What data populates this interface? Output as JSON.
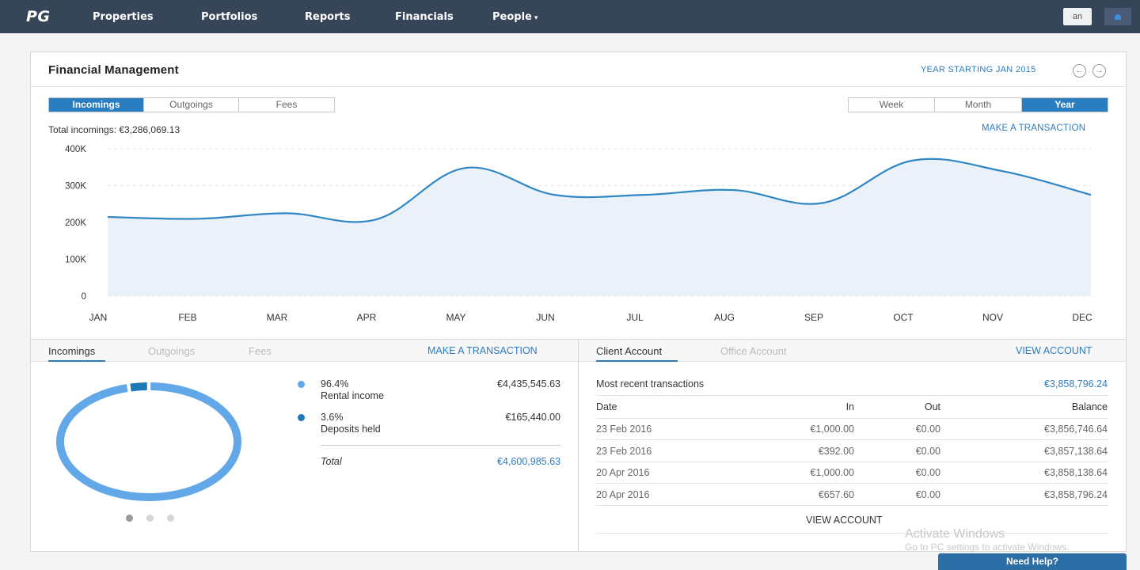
{
  "nav": {
    "logo": "PG",
    "items": [
      "Properties",
      "Portfolios",
      "Reports",
      "Financials",
      "People"
    ],
    "user_label": "an"
  },
  "header": {
    "title": "Financial Management",
    "year_label": "YEAR STARTING JAN 2015",
    "prev_icon": "←",
    "next_icon": "→"
  },
  "type_tabs": [
    "Incomings",
    "Outgoings",
    "Fees"
  ],
  "type_tab_active": 0,
  "period_tabs": [
    "Week",
    "Month",
    "Year"
  ],
  "period_tab_active": 2,
  "total_incomings": "Total incomings: €3,286,069.13",
  "make_transaction": "MAKE A TRANSACTION",
  "chart_data": {
    "type": "area",
    "categories": [
      "JAN",
      "FEB",
      "MAR",
      "APR",
      "MAY",
      "JUN",
      "JUL",
      "AUG",
      "SEP",
      "OCT",
      "NOV",
      "DEC"
    ],
    "y_tick_labels": [
      "400K",
      "300K",
      "200K",
      "100K",
      "0"
    ],
    "ylim": [
      0,
      400000
    ],
    "series": [
      {
        "values": [
          215000,
          210000,
          225000,
          208000,
          348000,
          275000,
          275000,
          288000,
          253000,
          368000,
          340000,
          275000
        ]
      }
    ],
    "colors": {
      "line": "#2f87c4",
      "fill": "#eaf1f8"
    },
    "grid": true
  },
  "bottom_left": {
    "tabs": [
      "Incomings",
      "Outgoings",
      "Fees"
    ],
    "active_tab": 0,
    "make_transaction": "MAKE A TRANSACTION",
    "donut": [
      {
        "pct": "96.4%",
        "name": "Rental income",
        "value": "€4,435,545.63",
        "fraction": 0.964,
        "color": "#62a8e8"
      },
      {
        "pct": "3.6%",
        "name": "Deposits held",
        "value": "€165,440.00",
        "fraction": 0.036,
        "color": "#1f78b8"
      }
    ],
    "total_label": "Total",
    "total_value": "€4,600,985.63"
  },
  "bottom_right": {
    "tabs": [
      "Client Account",
      "Office Account"
    ],
    "active_tab": 0,
    "view_account": "VIEW ACCOUNT",
    "recent_label": "Most recent transactions",
    "recent_value": "€3,858,796.24",
    "columns": [
      "Date",
      "In",
      "Out",
      "Balance"
    ],
    "rows": [
      {
        "date": "23 Feb 2016",
        "in": "€1,000.00",
        "out": "€0.00",
        "balance": "€3,856,746.64"
      },
      {
        "date": "23 Feb 2016",
        "in": "€392.00",
        "out": "€0.00",
        "balance": "€3,857,138.64"
      },
      {
        "date": "20 Apr 2016",
        "in": "€1,000.00",
        "out": "€0.00",
        "balance": "€3,858,138.64"
      },
      {
        "date": "20 Apr 2016",
        "in": "€657.60",
        "out": "€0.00",
        "balance": "€3,858,796.24"
      }
    ],
    "view_account_bottom": "VIEW ACCOUNT"
  },
  "watermark": {
    "line1": "Activate Windows",
    "line2": "Go to PC settings to activate Windows."
  },
  "help_button": "Need Help?"
}
